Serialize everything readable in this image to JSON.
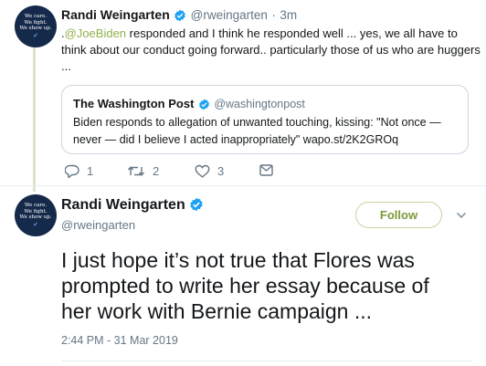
{
  "reply_tweet": {
    "avatar_text": [
      "We care.",
      "We fight.",
      "We show up."
    ],
    "avatar_mark": "✔",
    "display_name": "Randi Weingarten",
    "handle": "@rweingarten",
    "separator": "·",
    "time": "3m",
    "text_line1_prefix": ".",
    "mention": "@JoeBiden",
    "text_line1_suffix": " responded and I think he responded well ...  yes, we all have to",
    "text_line2": "think about our conduct going forward.. particularly those of us who are huggers",
    "text_line3": "...",
    "quote": {
      "display_name": "The Washington Post",
      "handle": "@washingtonpost",
      "text_line1": "Biden responds to allegation of unwanted touching, kissing: \"Not once —",
      "text_line2": "never — did I believe I acted inappropriately\" wapo.st/2K2GROq"
    },
    "actions": {
      "reply_count": "1",
      "retweet_count": "2",
      "like_count": "3"
    }
  },
  "main_tweet": {
    "avatar_text": [
      "We care.",
      "We fight.",
      "We show up."
    ],
    "avatar_mark": "✔",
    "display_name": "Randi Weingarten",
    "handle": "@rweingarten",
    "follow_label": "Follow",
    "text_line1": "I just hope it’s not true that Flores was",
    "text_line2": "prompted to write her essay because of",
    "text_line3": "her work with Bernie campaign ...",
    "timestamp": "2:44 PM - 31 Mar 2019"
  },
  "colors": {
    "link": "#91b14b",
    "verified": "#1da1f2",
    "follow": "#7c9a39",
    "thread_line": "#d9e4c8",
    "avatar_bg": "#15294a"
  }
}
